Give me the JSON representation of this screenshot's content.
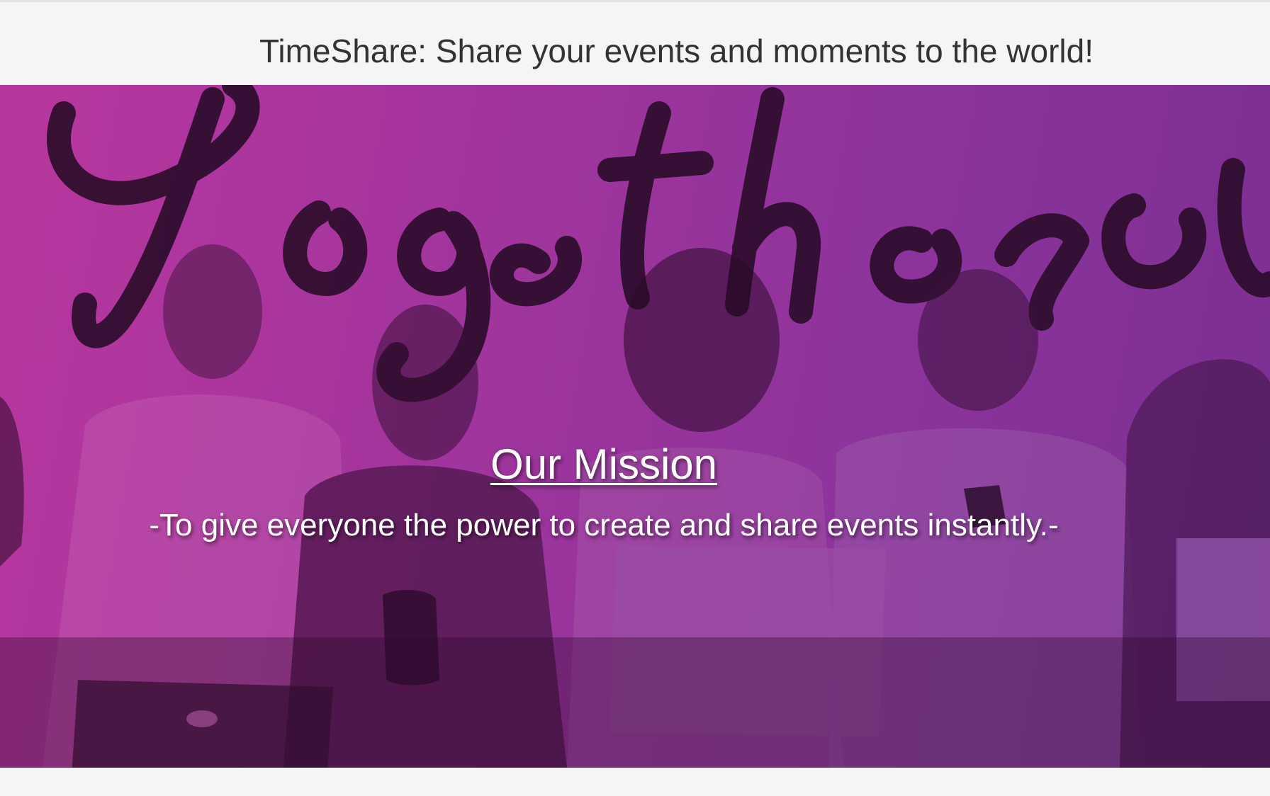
{
  "header": {
    "title": "TimeShare: Share your events and moments to the world!"
  },
  "hero": {
    "mission_title": "Our Mission",
    "mission_text": "-To give everyone the power to create and share events instantly.-",
    "background_image": "group of young people with laptops and phones sitting in front of a 'Together' script sign, purple-magenta tint"
  },
  "colors": {
    "page_background": "#f5f5f5",
    "title_text": "#333333",
    "hero_tint_left": "#b8379e",
    "hero_tint_right": "#7a2f92",
    "hero_text": "#ffffff"
  }
}
